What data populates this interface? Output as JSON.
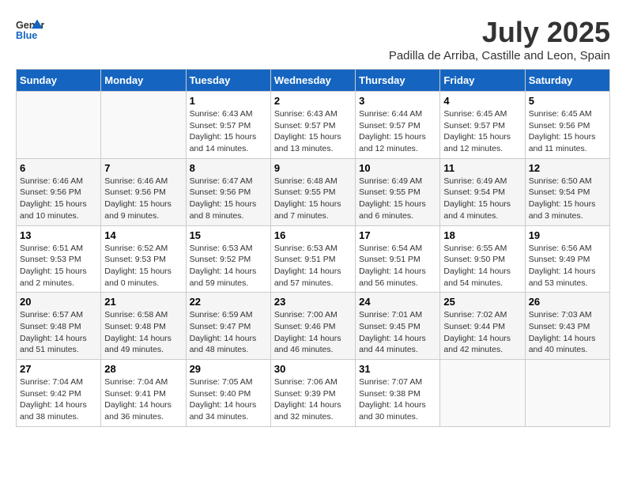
{
  "logo": {
    "line1": "General",
    "line2": "Blue"
  },
  "title": "July 2025",
  "subtitle": "Padilla de Arriba, Castille and Leon, Spain",
  "days_of_week": [
    "Sunday",
    "Monday",
    "Tuesday",
    "Wednesday",
    "Thursday",
    "Friday",
    "Saturday"
  ],
  "weeks": [
    [
      {
        "day": "",
        "info": ""
      },
      {
        "day": "",
        "info": ""
      },
      {
        "day": "1",
        "info": "Sunrise: 6:43 AM\nSunset: 9:57 PM\nDaylight: 15 hours and 14 minutes."
      },
      {
        "day": "2",
        "info": "Sunrise: 6:43 AM\nSunset: 9:57 PM\nDaylight: 15 hours and 13 minutes."
      },
      {
        "day": "3",
        "info": "Sunrise: 6:44 AM\nSunset: 9:57 PM\nDaylight: 15 hours and 12 minutes."
      },
      {
        "day": "4",
        "info": "Sunrise: 6:45 AM\nSunset: 9:57 PM\nDaylight: 15 hours and 12 minutes."
      },
      {
        "day": "5",
        "info": "Sunrise: 6:45 AM\nSunset: 9:56 PM\nDaylight: 15 hours and 11 minutes."
      }
    ],
    [
      {
        "day": "6",
        "info": "Sunrise: 6:46 AM\nSunset: 9:56 PM\nDaylight: 15 hours and 10 minutes."
      },
      {
        "day": "7",
        "info": "Sunrise: 6:46 AM\nSunset: 9:56 PM\nDaylight: 15 hours and 9 minutes."
      },
      {
        "day": "8",
        "info": "Sunrise: 6:47 AM\nSunset: 9:56 PM\nDaylight: 15 hours and 8 minutes."
      },
      {
        "day": "9",
        "info": "Sunrise: 6:48 AM\nSunset: 9:55 PM\nDaylight: 15 hours and 7 minutes."
      },
      {
        "day": "10",
        "info": "Sunrise: 6:49 AM\nSunset: 9:55 PM\nDaylight: 15 hours and 6 minutes."
      },
      {
        "day": "11",
        "info": "Sunrise: 6:49 AM\nSunset: 9:54 PM\nDaylight: 15 hours and 4 minutes."
      },
      {
        "day": "12",
        "info": "Sunrise: 6:50 AM\nSunset: 9:54 PM\nDaylight: 15 hours and 3 minutes."
      }
    ],
    [
      {
        "day": "13",
        "info": "Sunrise: 6:51 AM\nSunset: 9:53 PM\nDaylight: 15 hours and 2 minutes."
      },
      {
        "day": "14",
        "info": "Sunrise: 6:52 AM\nSunset: 9:53 PM\nDaylight: 15 hours and 0 minutes."
      },
      {
        "day": "15",
        "info": "Sunrise: 6:53 AM\nSunset: 9:52 PM\nDaylight: 14 hours and 59 minutes."
      },
      {
        "day": "16",
        "info": "Sunrise: 6:53 AM\nSunset: 9:51 PM\nDaylight: 14 hours and 57 minutes."
      },
      {
        "day": "17",
        "info": "Sunrise: 6:54 AM\nSunset: 9:51 PM\nDaylight: 14 hours and 56 minutes."
      },
      {
        "day": "18",
        "info": "Sunrise: 6:55 AM\nSunset: 9:50 PM\nDaylight: 14 hours and 54 minutes."
      },
      {
        "day": "19",
        "info": "Sunrise: 6:56 AM\nSunset: 9:49 PM\nDaylight: 14 hours and 53 minutes."
      }
    ],
    [
      {
        "day": "20",
        "info": "Sunrise: 6:57 AM\nSunset: 9:48 PM\nDaylight: 14 hours and 51 minutes."
      },
      {
        "day": "21",
        "info": "Sunrise: 6:58 AM\nSunset: 9:48 PM\nDaylight: 14 hours and 49 minutes."
      },
      {
        "day": "22",
        "info": "Sunrise: 6:59 AM\nSunset: 9:47 PM\nDaylight: 14 hours and 48 minutes."
      },
      {
        "day": "23",
        "info": "Sunrise: 7:00 AM\nSunset: 9:46 PM\nDaylight: 14 hours and 46 minutes."
      },
      {
        "day": "24",
        "info": "Sunrise: 7:01 AM\nSunset: 9:45 PM\nDaylight: 14 hours and 44 minutes."
      },
      {
        "day": "25",
        "info": "Sunrise: 7:02 AM\nSunset: 9:44 PM\nDaylight: 14 hours and 42 minutes."
      },
      {
        "day": "26",
        "info": "Sunrise: 7:03 AM\nSunset: 9:43 PM\nDaylight: 14 hours and 40 minutes."
      }
    ],
    [
      {
        "day": "27",
        "info": "Sunrise: 7:04 AM\nSunset: 9:42 PM\nDaylight: 14 hours and 38 minutes."
      },
      {
        "day": "28",
        "info": "Sunrise: 7:04 AM\nSunset: 9:41 PM\nDaylight: 14 hours and 36 minutes."
      },
      {
        "day": "29",
        "info": "Sunrise: 7:05 AM\nSunset: 9:40 PM\nDaylight: 14 hours and 34 minutes."
      },
      {
        "day": "30",
        "info": "Sunrise: 7:06 AM\nSunset: 9:39 PM\nDaylight: 14 hours and 32 minutes."
      },
      {
        "day": "31",
        "info": "Sunrise: 7:07 AM\nSunset: 9:38 PM\nDaylight: 14 hours and 30 minutes."
      },
      {
        "day": "",
        "info": ""
      },
      {
        "day": "",
        "info": ""
      }
    ]
  ]
}
